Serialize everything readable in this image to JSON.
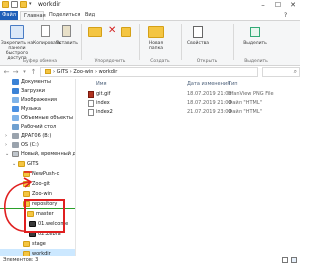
{
  "window": {
    "title": "workdir",
    "controls": {
      "minimize": "–",
      "maximize": "☐",
      "close": "✕"
    }
  },
  "ribbon": {
    "tabs": {
      "file": "Файл",
      "home": "Главная",
      "share": "Поделиться",
      "view": "Вид"
    },
    "clipboard": {
      "pin": "Закрепить на панели",
      "pin2": "быстрого доступа",
      "copy": "Копировать",
      "paste": "Вставить",
      "group": "Буфер обмена"
    },
    "organize": {
      "group": "Упорядочить"
    },
    "create": {
      "new_folder": "Новая",
      "new_folder2": "папка",
      "group": "Создать"
    },
    "open": {
      "properties": "Свойства",
      "group": "Открыть"
    },
    "select": {
      "select": "Выделить",
      "group": "Выделить"
    }
  },
  "address": {
    "path": [
      "GITS",
      "Zoo-win",
      "workdir"
    ],
    "separator": "›"
  },
  "navpane": {
    "items": [
      {
        "label": "Документы",
        "icon": "documents-icon"
      },
      {
        "label": "Загрузки",
        "icon": "downloads-icon"
      },
      {
        "label": "Изображения",
        "icon": "pictures-icon"
      },
      {
        "label": "Музыка",
        "icon": "music-icon"
      },
      {
        "label": "Объемные объекты",
        "icon": "3d-objects-icon"
      },
      {
        "label": "Рабочий стол",
        "icon": "desktop-icon"
      },
      {
        "label": "ДРАГ06 (В:)",
        "icon": "drive-icon"
      },
      {
        "label": "OS (C:)",
        "icon": "drive-icon"
      },
      {
        "label": "Новый, временный диск (E:)",
        "icon": "disk-icon"
      },
      {
        "label": "GITS",
        "icon": "folder-icon"
      },
      {
        "label": "NewPush-c",
        "icon": "folder-icon"
      },
      {
        "label": "Zoo-git",
        "icon": "folder-icon"
      },
      {
        "label": "Zoo-win",
        "icon": "folder-icon"
      },
      {
        "label": "repository",
        "icon": "folder-icon"
      },
      {
        "label": "master",
        "icon": "folder-icon"
      },
      {
        "label": "01.welcome",
        "icon": "image-icon"
      },
      {
        "label": "02.Zebra",
        "icon": "image-icon"
      },
      {
        "label": "stage",
        "icon": "folder-icon"
      },
      {
        "label": "workdir",
        "icon": "folder-icon"
      }
    ]
  },
  "content": {
    "columns": {
      "name": "Имя",
      "date": "Дата изменения",
      "type": "Тип"
    },
    "files": [
      {
        "name": "git.gif",
        "date": "18.07.2019 21:08",
        "type": "IrfanView PNG File",
        "icon": "gif-file-icon"
      },
      {
        "name": "index",
        "date": "18.07.2019 21:09",
        "type": "Файл \"HTML\"",
        "icon": "html-file-icon"
      },
      {
        "name": "index2",
        "date": "21.07.2019 23:09",
        "type": "Файл \"HTML\"",
        "icon": "html-file-icon"
      }
    ]
  },
  "status": {
    "text": "Элементов: 3"
  },
  "colors": {
    "accent": "#1f5fb8",
    "annotation": "#e02020",
    "selected": "#cce8ff",
    "folder": "#f4c542"
  }
}
